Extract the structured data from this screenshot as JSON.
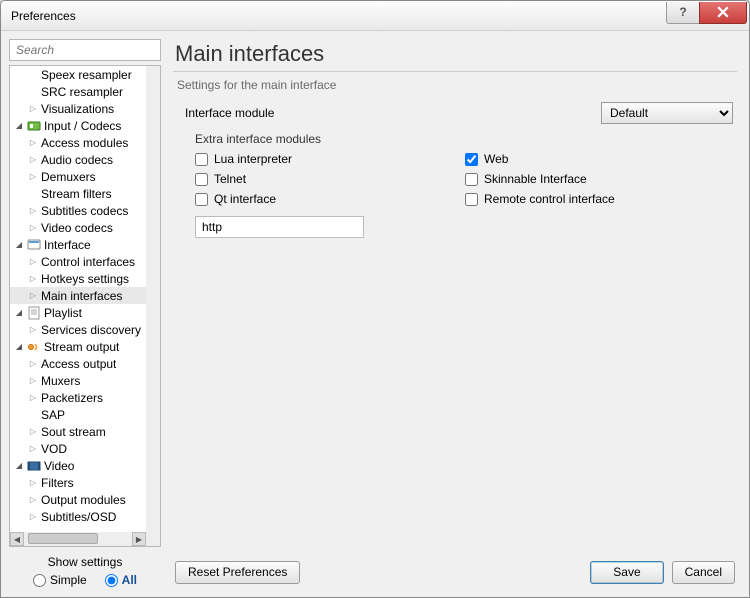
{
  "window": {
    "title": "Preferences"
  },
  "titlebar_buttons": {
    "help": "?",
    "close": "✕"
  },
  "search": {
    "placeholder": "Search"
  },
  "tree": {
    "items": [
      {
        "label": "Speex resampler",
        "twist": "blank",
        "icon": null,
        "depth": 1
      },
      {
        "label": "SRC resampler",
        "twist": "blank",
        "icon": null,
        "depth": 1
      },
      {
        "label": "Visualizations",
        "twist": "col",
        "icon": null,
        "depth": 1
      },
      {
        "label": "Input / Codecs",
        "twist": "exp",
        "icon": "codecs",
        "depth": 0
      },
      {
        "label": "Access modules",
        "twist": "col",
        "icon": null,
        "depth": 1
      },
      {
        "label": "Audio codecs",
        "twist": "col",
        "icon": null,
        "depth": 1
      },
      {
        "label": "Demuxers",
        "twist": "col",
        "icon": null,
        "depth": 1
      },
      {
        "label": "Stream filters",
        "twist": "blank",
        "icon": null,
        "depth": 1
      },
      {
        "label": "Subtitles codecs",
        "twist": "col",
        "icon": null,
        "depth": 1
      },
      {
        "label": "Video codecs",
        "twist": "col",
        "icon": null,
        "depth": 1
      },
      {
        "label": "Interface",
        "twist": "exp",
        "icon": "interface",
        "depth": 0
      },
      {
        "label": "Control interfaces",
        "twist": "col",
        "icon": null,
        "depth": 1
      },
      {
        "label": "Hotkeys settings",
        "twist": "col",
        "icon": null,
        "depth": 1
      },
      {
        "label": "Main interfaces",
        "twist": "col",
        "icon": null,
        "depth": 1,
        "selected": true
      },
      {
        "label": "Playlist",
        "twist": "exp",
        "icon": "playlist",
        "depth": 0
      },
      {
        "label": "Services discovery",
        "twist": "col",
        "icon": null,
        "depth": 1
      },
      {
        "label": "Stream output",
        "twist": "exp",
        "icon": "stream",
        "depth": 0
      },
      {
        "label": "Access output",
        "twist": "col",
        "icon": null,
        "depth": 1
      },
      {
        "label": "Muxers",
        "twist": "col",
        "icon": null,
        "depth": 1
      },
      {
        "label": "Packetizers",
        "twist": "col",
        "icon": null,
        "depth": 1
      },
      {
        "label": "SAP",
        "twist": "blank",
        "icon": null,
        "depth": 1
      },
      {
        "label": "Sout stream",
        "twist": "col",
        "icon": null,
        "depth": 1
      },
      {
        "label": "VOD",
        "twist": "col",
        "icon": null,
        "depth": 1
      },
      {
        "label": "Video",
        "twist": "exp",
        "icon": "video",
        "depth": 0
      },
      {
        "label": "Filters",
        "twist": "col",
        "icon": null,
        "depth": 1
      },
      {
        "label": "Output modules",
        "twist": "col",
        "icon": null,
        "depth": 1
      },
      {
        "label": "Subtitles/OSD",
        "twist": "col",
        "icon": null,
        "depth": 1
      }
    ]
  },
  "show_settings": {
    "label": "Show settings",
    "simple": "Simple",
    "all": "All",
    "selected": "all"
  },
  "main": {
    "heading": "Main interfaces",
    "subtitle": "Settings for the main interface",
    "interface_module_label": "Interface module",
    "interface_module_value": "Default",
    "extra_group_label": "Extra interface modules",
    "checkboxes": {
      "lua": {
        "label": "Lua interpreter",
        "checked": false
      },
      "web": {
        "label": "Web",
        "checked": true
      },
      "telnet": {
        "label": "Telnet",
        "checked": false
      },
      "skin": {
        "label": "Skinnable Interface",
        "checked": false
      },
      "qt": {
        "label": "Qt interface",
        "checked": false
      },
      "rc": {
        "label": "Remote control interface",
        "checked": false
      }
    },
    "text_value": "http"
  },
  "footer": {
    "reset": "Reset Preferences",
    "save": "Save",
    "cancel": "Cancel"
  }
}
